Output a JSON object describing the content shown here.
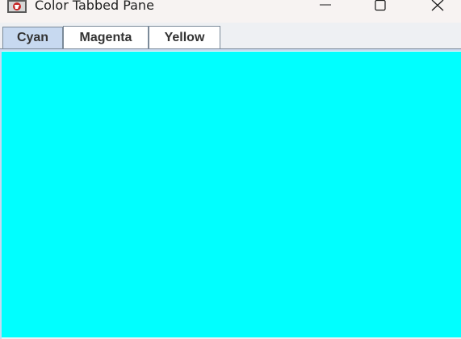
{
  "window": {
    "title": "Color Tabbed Pane",
    "icon": "java-app-icon",
    "controls": {
      "minimize": "minimize-icon",
      "maximize": "maximize-icon",
      "close": "close-icon"
    }
  },
  "tabs": [
    {
      "label": "Cyan",
      "selected": true,
      "color": "#00ffff"
    },
    {
      "label": "Magenta",
      "selected": false,
      "color": "#ff00ff"
    },
    {
      "label": "Yellow",
      "selected": false,
      "color": "#ffff00"
    }
  ],
  "content": {
    "background_color": "#00ffff"
  },
  "colors": {
    "selected_tab": "#c7d9f0",
    "tab_border": "#7b8a99",
    "tab_text": "#333333"
  }
}
